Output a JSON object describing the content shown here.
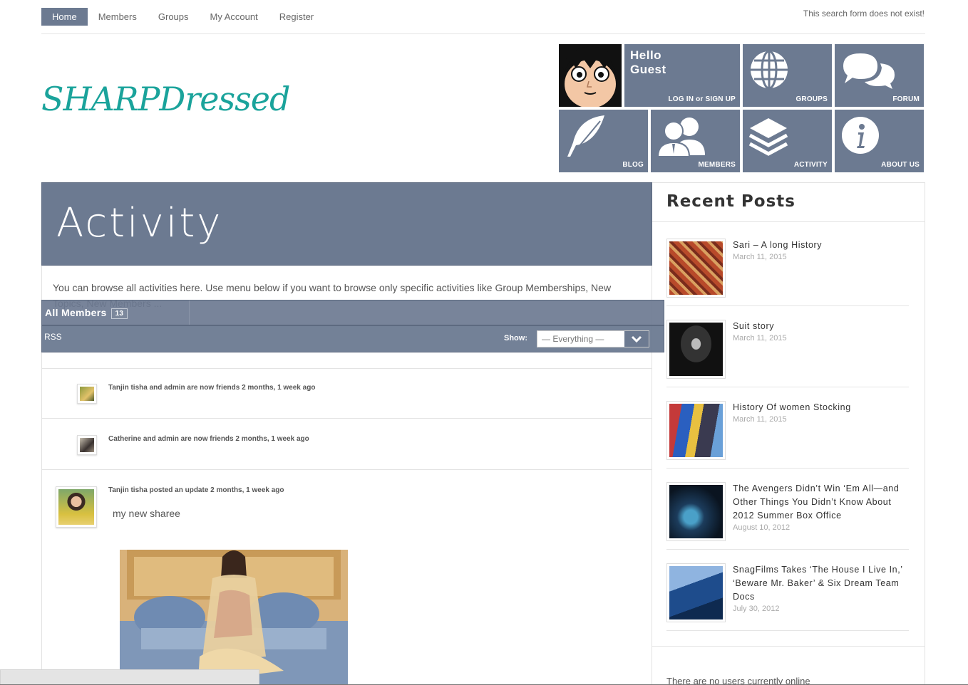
{
  "nav": {
    "items": [
      "Home",
      "Members",
      "Groups",
      "My Account",
      "Register"
    ],
    "search_message": "This search form does not exist!"
  },
  "logo": {
    "text": "SHARPDressed"
  },
  "tiles": {
    "hello": "Hello",
    "guest": "Guest",
    "login": "LOG IN or SIGN UP",
    "groups": "GROUPS",
    "forum": "FORUM",
    "blog": "BLOG",
    "members": "MEMBERS",
    "activity": "ACTIVITY",
    "about": "ABOUT US"
  },
  "activity": {
    "title": "Activity",
    "intro": "You can browse all activities here. Use menu below if you want to browse only specific activities like Group Memberships, New Topics, New Members ...",
    "tab_all": "All Members",
    "tab_count": "13",
    "rss": "RSS",
    "show_label": "Show:",
    "show_value": "— Everything —",
    "items": [
      {
        "text": "Tanjin tisha and admin are now friends 2 months, 1 week ago"
      },
      {
        "text": "Catherine and admin are now friends 2 months, 1 week ago"
      },
      {
        "text": "Tanjin tisha posted an update 2 months, 1 week ago",
        "content": "my new sharee"
      }
    ]
  },
  "sidebar": {
    "title": "Recent Posts",
    "posts": [
      {
        "title": "Sari – A long History",
        "date": "March 11, 2015"
      },
      {
        "title": "Suit story",
        "date": "March 11, 2015"
      },
      {
        "title": "History Of women Stocking",
        "date": "March 11, 2015"
      },
      {
        "title": "The Avengers Didn’t Win ‘Em All—and Other Things You Didn’t Know About 2012 Summer Box Office",
        "date": "August 10, 2012"
      },
      {
        "title": "SnagFilms Takes ‘The House I Live In,’ ‘Beware Mr. Baker’ & Six Dream Team Docs",
        "date": "July 30, 2012"
      }
    ],
    "online": "There are no users currently online"
  },
  "colors": {
    "tile": "#6c7a91",
    "logo": "#1aa39b"
  }
}
